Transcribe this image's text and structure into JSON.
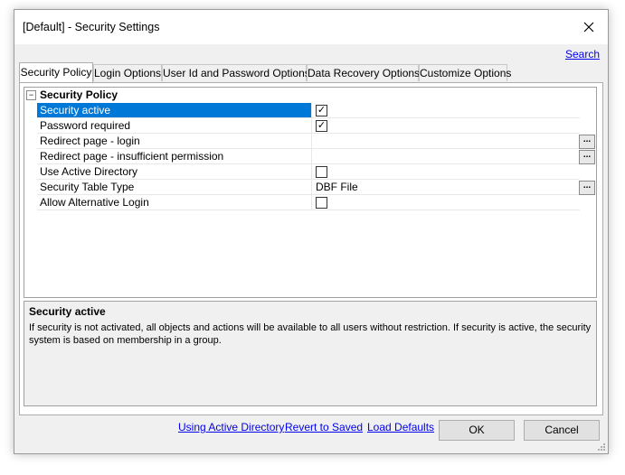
{
  "window": {
    "title": "[Default] - Security Settings"
  },
  "search_link": "Search",
  "tabs": [
    {
      "label": "Security Policy",
      "active": true
    },
    {
      "label": "Login Options"
    },
    {
      "label": "User Id and Password Options"
    },
    {
      "label": "Data Recovery Options"
    },
    {
      "label": "Customize Options"
    }
  ],
  "grid": {
    "category": {
      "label": "Security Policy",
      "expander": "−"
    },
    "rows": [
      {
        "name": "Security active",
        "type": "checkbox",
        "checked": true,
        "check_glyph": "✓"
      },
      {
        "name": "Password required",
        "type": "checkbox",
        "checked": true,
        "check_glyph": "✓"
      },
      {
        "name": "Redirect page - login",
        "type": "ellipsis",
        "value": "",
        "button": "..."
      },
      {
        "name": "Redirect page - insufficient permission",
        "type": "ellipsis",
        "value": "",
        "button": "..."
      },
      {
        "name": "Use Active Directory",
        "type": "checkbox",
        "checked": false,
        "check_glyph": ""
      },
      {
        "name": "Security Table Type",
        "type": "ellipsis",
        "value": "DBF File",
        "button": "..."
      },
      {
        "name": "Allow Alternative Login",
        "type": "checkbox",
        "checked": false,
        "check_glyph": ""
      }
    ]
  },
  "description": {
    "title": "Security active",
    "text": "If security is not activated, all objects and actions will be available to all users without restriction.  If security is active, the security system is based on membership in a group."
  },
  "footer": {
    "links": [
      "Using Active Directory",
      "Revert to Saved",
      "Load Defaults"
    ],
    "ok_label": "OK",
    "cancel_label": "Cancel"
  },
  "colors": {
    "selection": "#0078d7",
    "link": "#0000ee"
  }
}
